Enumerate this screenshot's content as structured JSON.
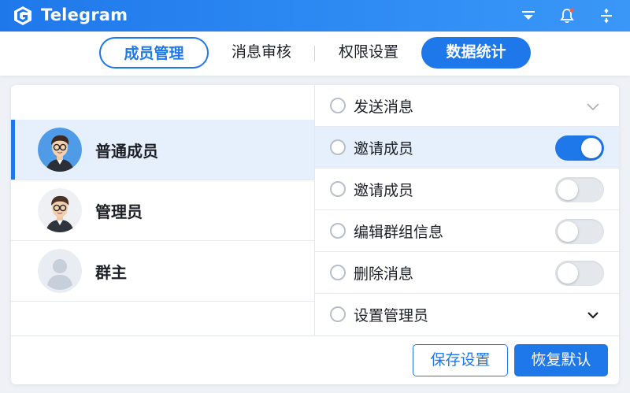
{
  "app": {
    "title": "Telegram"
  },
  "colors": {
    "accent": "#1f78ea",
    "notification_dot": "#ff5a3c",
    "highlight_row": "#e6f0fc"
  },
  "topbar_icons": [
    "dropdown-icon",
    "bell-icon",
    "sliders-icon"
  ],
  "tabs": [
    {
      "label": "成员管理",
      "state": "outlined"
    },
    {
      "label": "消息审核",
      "state": "plain"
    },
    {
      "label": "权限设置",
      "state": "plain"
    },
    {
      "label": "数据统计",
      "state": "filled"
    }
  ],
  "roles": [
    {
      "label": "普通成员",
      "selected": true,
      "avatar": "avatar-glasses-man"
    },
    {
      "label": "管理员",
      "selected": false,
      "avatar": "avatar-glasses-man-2"
    },
    {
      "label": "群主",
      "selected": false,
      "avatar": "avatar-placeholder"
    }
  ],
  "permissions": [
    {
      "label": "发送消息",
      "control": "chevron-down-light",
      "highlight": false
    },
    {
      "label": "邀请成员",
      "control": "toggle",
      "on": true,
      "highlight": true
    },
    {
      "label": "邀请成员",
      "control": "toggle",
      "on": false,
      "highlight": false
    },
    {
      "label": "编辑群组信息",
      "control": "toggle",
      "on": false,
      "highlight": false
    },
    {
      "label": "删除消息",
      "control": "toggle",
      "on": false,
      "highlight": false
    },
    {
      "label": "设置管理员",
      "control": "chevron-down-dark",
      "highlight": false
    }
  ],
  "actions": {
    "save": "保存设置",
    "reset": "恢复默认"
  }
}
